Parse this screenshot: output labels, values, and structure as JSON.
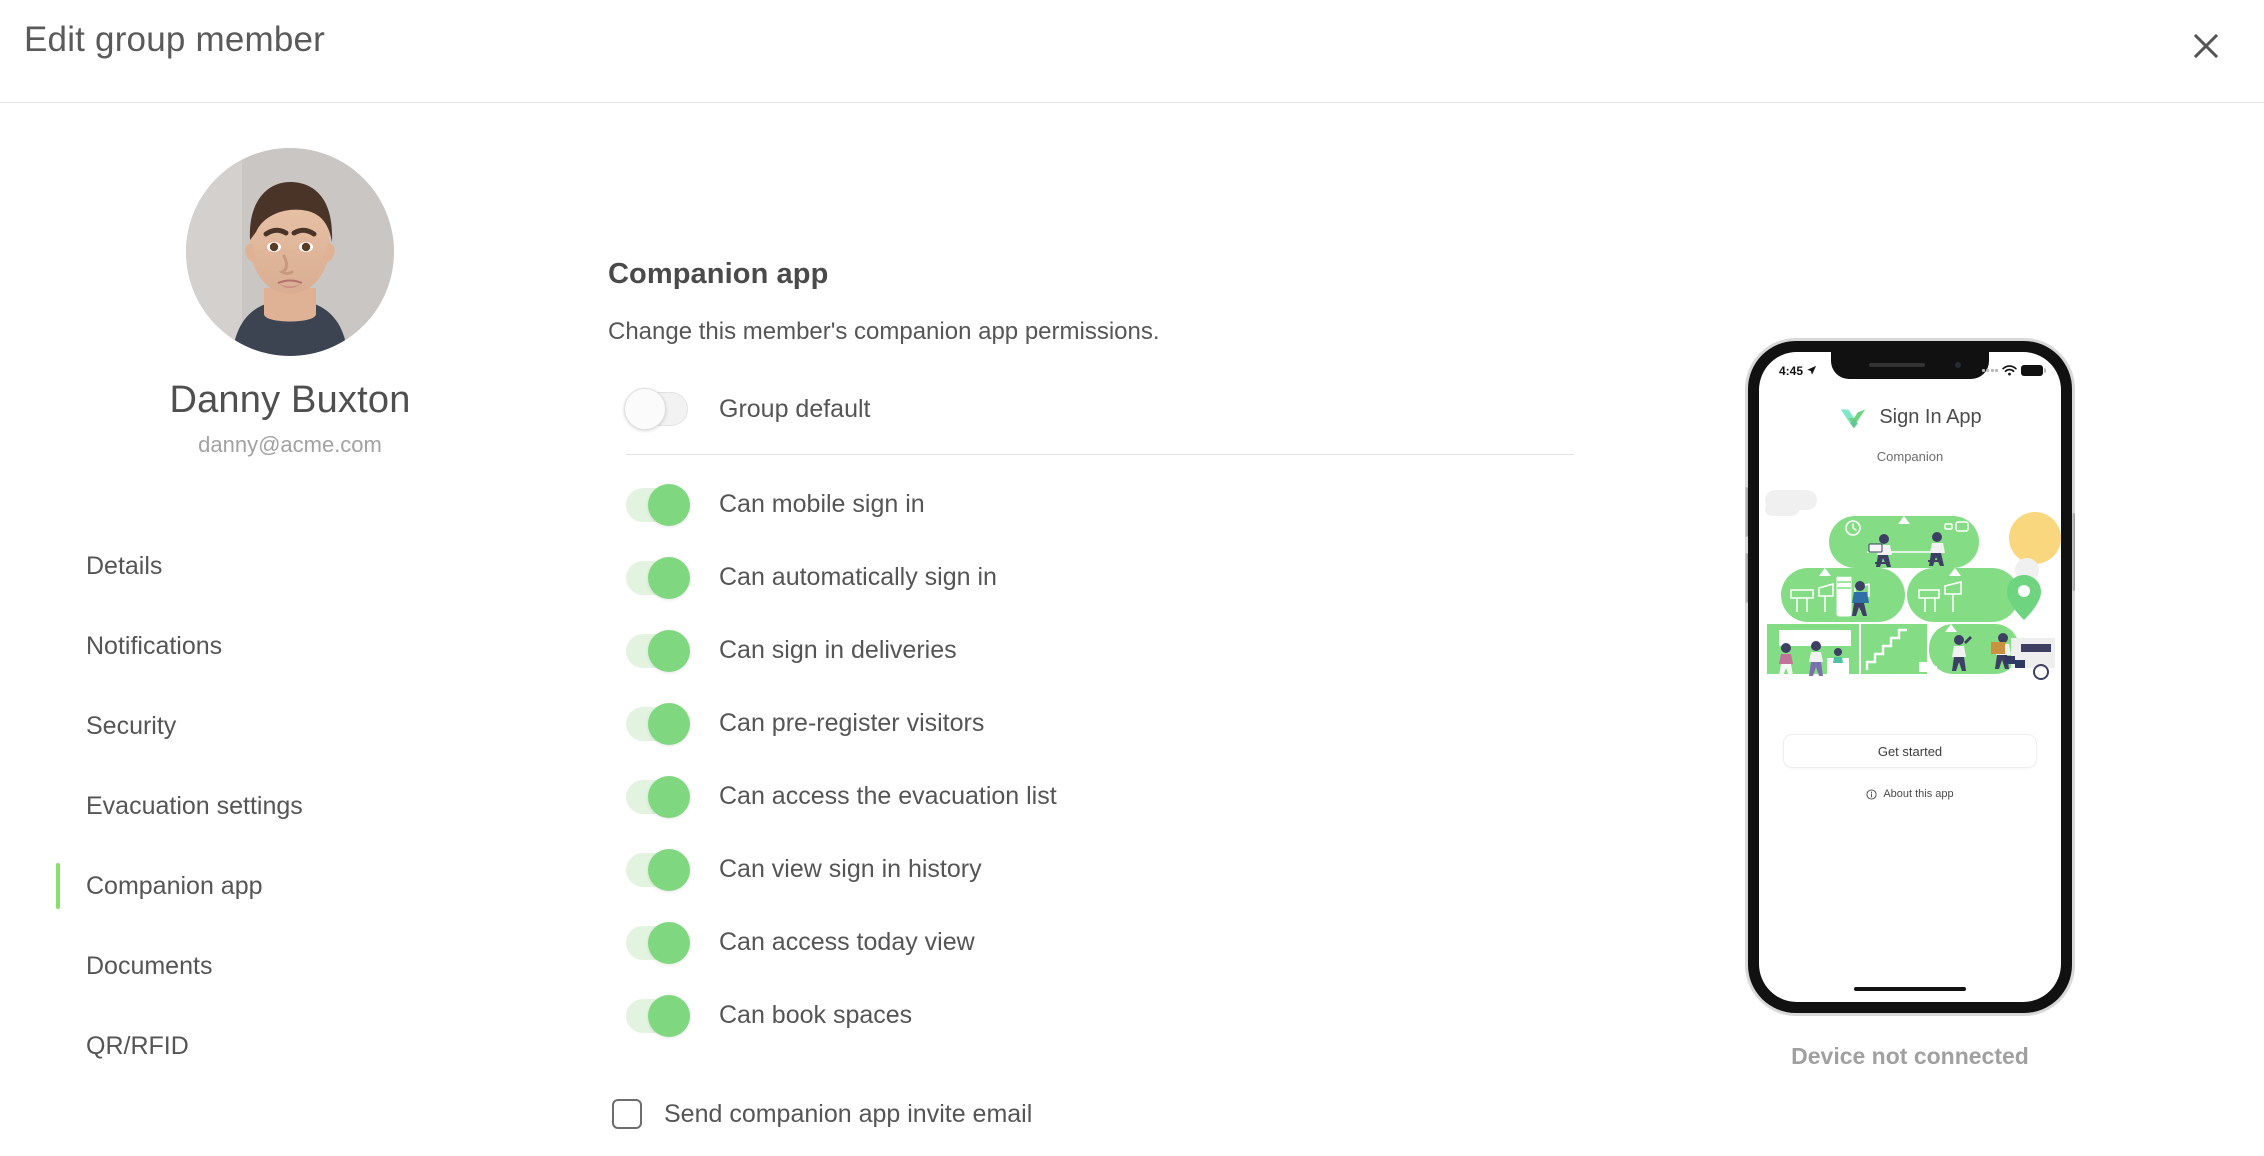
{
  "header": {
    "title": "Edit group member",
    "close_icon": "close-icon"
  },
  "member": {
    "name": "Danny Buxton",
    "email": "danny@acme.com",
    "avatar_alt": "member-photo"
  },
  "sidebar": {
    "items": [
      {
        "label": "Details",
        "active": false
      },
      {
        "label": "Notifications",
        "active": false
      },
      {
        "label": "Security",
        "active": false
      },
      {
        "label": "Evacuation settings",
        "active": false
      },
      {
        "label": "Companion app",
        "active": true
      },
      {
        "label": "Documents",
        "active": false
      },
      {
        "label": "QR/RFID",
        "active": false
      }
    ],
    "active_indicator_color": "#8ade6f"
  },
  "main": {
    "section_title": "Companion app",
    "section_description": "Change this member's companion app permissions.",
    "group_default": {
      "label": "Group default",
      "state": "off"
    },
    "permissions": [
      {
        "label": "Can mobile sign in",
        "state": "on"
      },
      {
        "label": "Can automatically sign in",
        "state": "on"
      },
      {
        "label": "Can sign in deliveries",
        "state": "on"
      },
      {
        "label": "Can pre-register visitors",
        "state": "on"
      },
      {
        "label": "Can access the evacuation list",
        "state": "on"
      },
      {
        "label": "Can view sign in history",
        "state": "on"
      },
      {
        "label": "Can access today view",
        "state": "on"
      },
      {
        "label": "Can book spaces",
        "state": "on"
      }
    ],
    "invite_checkbox": {
      "label": "Send companion app invite email",
      "checked": false
    }
  },
  "phone_preview": {
    "status_bar": {
      "time": "4:45",
      "location_icon": "location-arrow-icon",
      "wifi_icon": "wifi-icon",
      "battery_icon": "battery-icon"
    },
    "brand_name": "Sign In App",
    "brand_logo_icon": "sign-in-app-check-logo",
    "subtitle": "Companion",
    "illustration_alt": "office-workspace-illustration",
    "get_started_label": "Get started",
    "about_label": "About this app",
    "about_icon": "info-circle-icon",
    "device_status": "Device not connected"
  },
  "colors": {
    "toggle_on_knob": "#7fd87f",
    "toggle_on_track": "#e2f4e0",
    "toggle_off_track": "#f2f2f2",
    "accent_green": "#8ade6f",
    "illustration_green": "#84dd85",
    "illustration_yellow": "#f9d77e",
    "figure_navy": "#3d3f63"
  }
}
